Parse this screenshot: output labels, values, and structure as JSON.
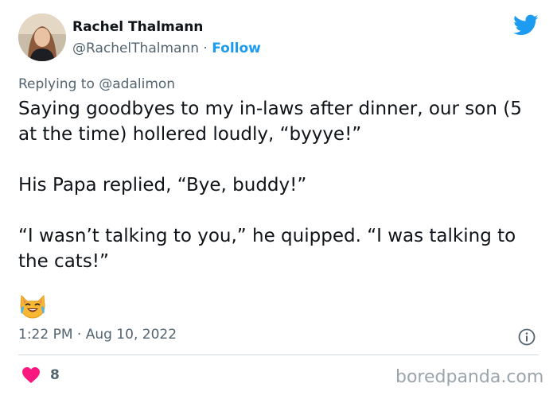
{
  "author": {
    "name": "Rachel Thalmann",
    "handle": "@RachelThalmann",
    "separator": "·",
    "follow_label": "Follow"
  },
  "reply": {
    "prefix": "Replying to",
    "mention": "@adalimon"
  },
  "tweet": {
    "paragraphs": [
      "Saying goodbyes to my in-laws after dinner, our son (5 at the time) hollered loudly, “byyye!”",
      "His Papa replied, “Bye, buddy!”",
      "“I wasn’t talking to you,” he quipped. “I was talking to the cats!”"
    ],
    "timestamp": "1:22 PM · Aug 10, 2022"
  },
  "engagement": {
    "likes": "8"
  },
  "watermark": "boredpanda.com",
  "colors": {
    "accent": "#1d9bf0",
    "heart": "#f91880",
    "muted": "#536471"
  },
  "icons": {
    "brand": "twitter-bird-icon",
    "emoji": "cat-face-with-tears-of-joy-icon",
    "info": "info-icon",
    "like": "heart-icon"
  }
}
